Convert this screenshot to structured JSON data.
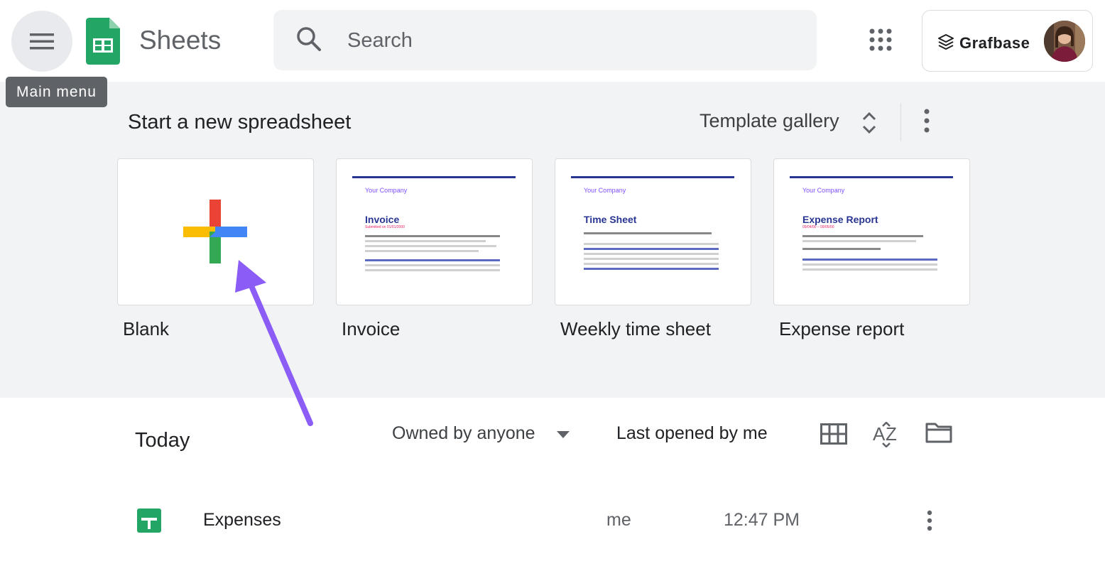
{
  "header": {
    "app_title": "Sheets",
    "menu_tooltip": "Main menu",
    "search_placeholder": "Search",
    "account_name": "Grafbase"
  },
  "templates": {
    "heading": "Start a new spreadsheet",
    "gallery_label": "Template gallery",
    "cards": [
      {
        "label": "Blank"
      },
      {
        "label": "Invoice",
        "company": "Your Company",
        "doc_title": "Invoice",
        "doc_sub": "Submitted on 01/01/2000"
      },
      {
        "label": "Weekly time sheet",
        "company": "Your Company",
        "doc_title": "Time Sheet",
        "doc_sub": ""
      },
      {
        "label": "Expense report",
        "company": "Your Company",
        "doc_title": "Expense Report",
        "doc_sub": "09/04/00 – 09/05/00"
      }
    ]
  },
  "recent": {
    "section_title": "Today",
    "owner_filter": "Owned by anyone",
    "sort_label": "Last opened by me",
    "files": [
      {
        "name": "Expenses",
        "owner": "me",
        "time": "12:47 PM"
      }
    ]
  },
  "colors": {
    "sheets_green": "#23a566",
    "arrow_purple": "#8b5cf6",
    "doc_blue": "#283593"
  }
}
